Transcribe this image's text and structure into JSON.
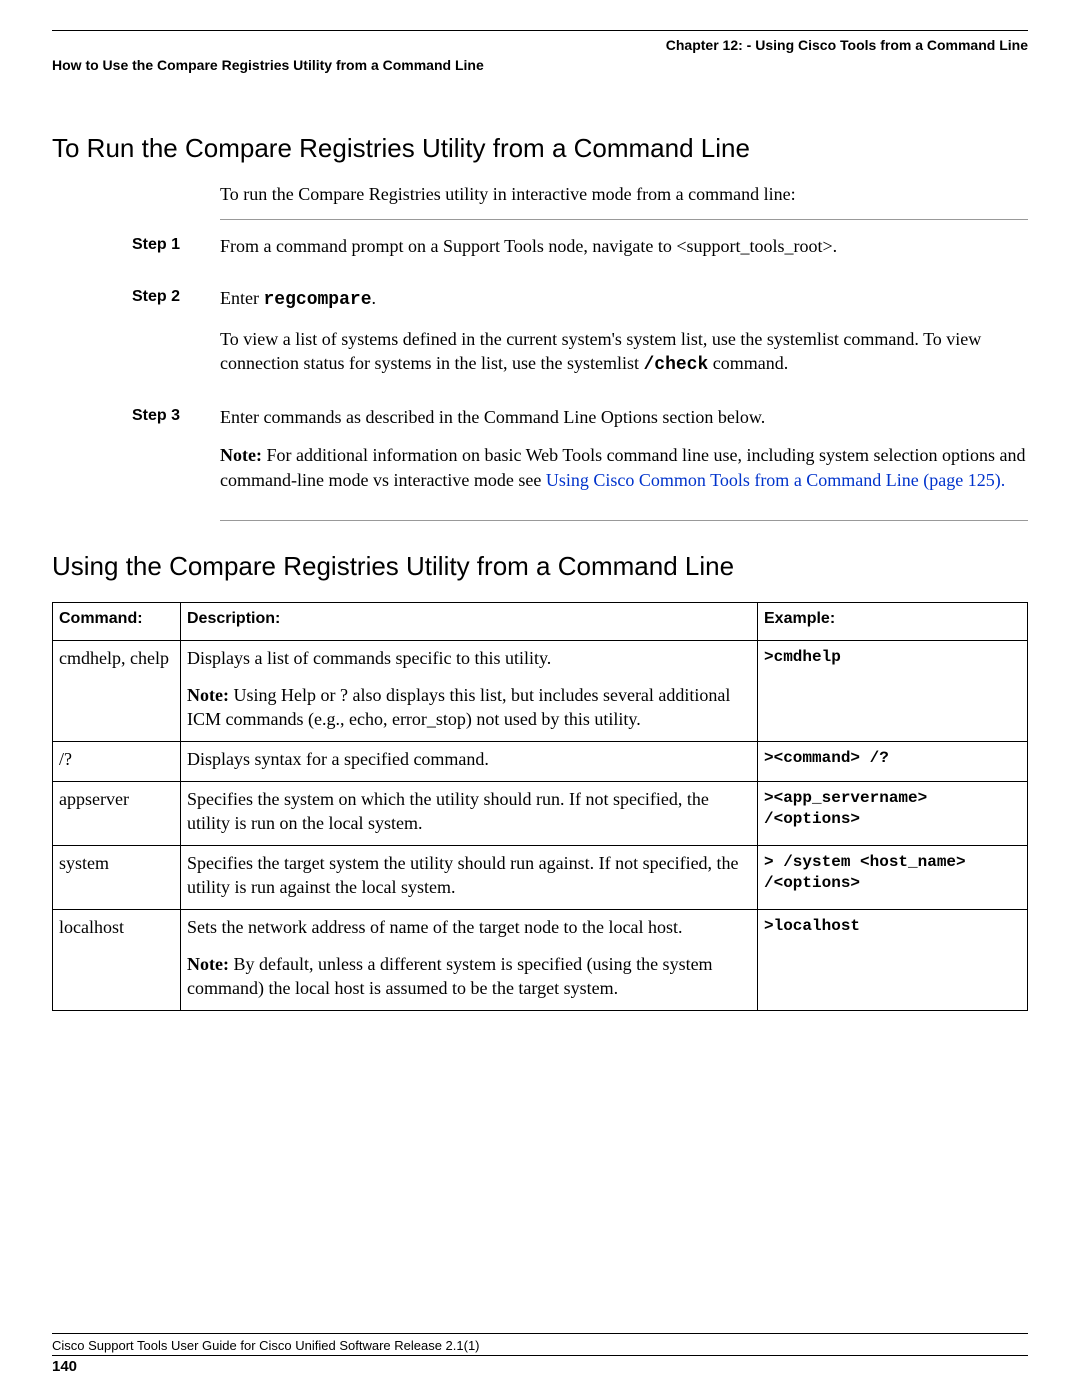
{
  "header": {
    "chapter": "Chapter 12: - Using Cisco Tools from a Command Line",
    "breadcrumb": "How to Use the Compare Registries Utility from a Command Line"
  },
  "section1": {
    "title": "To Run the Compare Registries Utility from a Command Line",
    "intro": "To run the Compare Registries utility in interactive mode from a command line:",
    "steps": [
      {
        "label": "Step 1",
        "p1": "From a command prompt on a Support Tools node, navigate to <support_tools_root>."
      },
      {
        "label": "Step 2",
        "p1_pre": "Enter ",
        "p1_code": "regcompare",
        "p1_post": ".",
        "p2_pre": "To view a list of systems defined in the current system's system list, use the systemlist command. To view connection status for systems in the list, use the systemlist ",
        "p2_code": "/check",
        "p2_post": " command."
      },
      {
        "label": "Step 3",
        "p1": "Enter commands as described in the Command Line Options section below.",
        "note_pre": "Note:",
        "note_text": " For additional information on basic Web Tools command line use, including system selection options and command-line mode vs interactive mode see ",
        "note_link": "Using Cisco Common Tools from a Command Line (page 125).",
        "note_post": ""
      }
    ]
  },
  "section2": {
    "title": "Using the Compare Registries Utility from a Command Line",
    "headers": {
      "c1": "Command:",
      "c2": "Description:",
      "c3": "Example:"
    },
    "rows": [
      {
        "cmd": "cmdhelp, chelp",
        "d1": "Displays a list of commands specific to this utility.",
        "d2_b": "Note:",
        "d2": " Using Help or ? also displays this list, but includes several additional ICM commands (e.g., echo, error_stop) not used by this utility.",
        "ex": ">cmdhelp"
      },
      {
        "cmd": "/?",
        "d1": "Displays syntax for a specified command.",
        "ex": "><command> /?"
      },
      {
        "cmd": "appserver",
        "d1": "Specifies the system on which the utility should run. If not specified, the utility is run on the local system.",
        "ex": "><app_servername> /<options>"
      },
      {
        "cmd": "system",
        "d1": "Specifies the target system the utility should run against. If not specified, the utility is run against the local system.",
        "ex": "> /system <host_name> /<options>"
      },
      {
        "cmd": "localhost",
        "d1": "Sets the network address of name of the target node to the local host.",
        "d2_b": "Note:",
        "d2": " By default, unless a different system is specified (using the system command) the local host is assumed to be the target system.",
        "ex": ">localhost"
      }
    ]
  },
  "footer": {
    "doc": "Cisco Support Tools User Guide for Cisco Unified Software Release 2.1(1)",
    "page": "140"
  }
}
